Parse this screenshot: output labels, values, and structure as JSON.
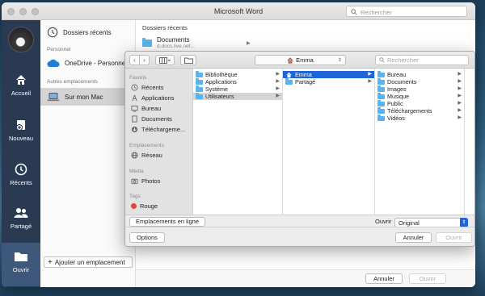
{
  "word": {
    "title": "Microsoft Word",
    "search_placeholder": "Rechercher",
    "rail": [
      {
        "label": "Accueil",
        "icon": "home-icon"
      },
      {
        "label": "Nouveau",
        "icon": "new-doc-icon"
      },
      {
        "label": "Récents",
        "icon": "clock-icon"
      },
      {
        "label": "Partagé",
        "icon": "people-icon"
      },
      {
        "label": "Ouvrir",
        "icon": "folder-icon"
      }
    ],
    "left": {
      "recent_label": "Dossiers récents",
      "personal_header": "Personnel",
      "onedrive_label": "OneDrive - Personnel",
      "other_header": "Autres emplacements",
      "mac_label": "Sur mon Mac",
      "add_label": "Ajouter un emplacement"
    },
    "right": {
      "header": "Dossiers récents",
      "doc_name": "Documents",
      "doc_url": "d.docs.live.net..."
    },
    "footer": {
      "cancel": "Annuler",
      "open": "Ouvrir"
    }
  },
  "dialog": {
    "location": "Emma",
    "search_placeholder": "Rechercher",
    "sidebar": {
      "fav_header": "Favoris",
      "favorites": [
        "Récents",
        "Applications",
        "Bureau",
        "Documents",
        "Téléchargeme..."
      ],
      "loc_header": "Emplacements",
      "locations": [
        "Réseau"
      ],
      "media_header": "Média",
      "media": [
        "Photos"
      ],
      "tags_header": "Tags",
      "tags": [
        "Rouge"
      ]
    },
    "col1": [
      "Bibliothèque",
      "Applications",
      "Système",
      "Utilisateurs"
    ],
    "col2": [
      "Emma",
      "Partagé"
    ],
    "col3": [
      "Bureau",
      "Documents",
      "Images",
      "Musique",
      "Public",
      "Téléchargements",
      "Vidéos"
    ],
    "online_btn": "Emplacements en ligne",
    "open_label": "Ouvrir",
    "format_value": "Original",
    "options_btn": "Options",
    "cancel_btn": "Annuler",
    "open_btn": "Ouvrir"
  },
  "colors": {
    "accent": "#1e65d8",
    "rail": "#293a52",
    "folder": "#5ab3ee",
    "tag_red": "#e0443e"
  }
}
